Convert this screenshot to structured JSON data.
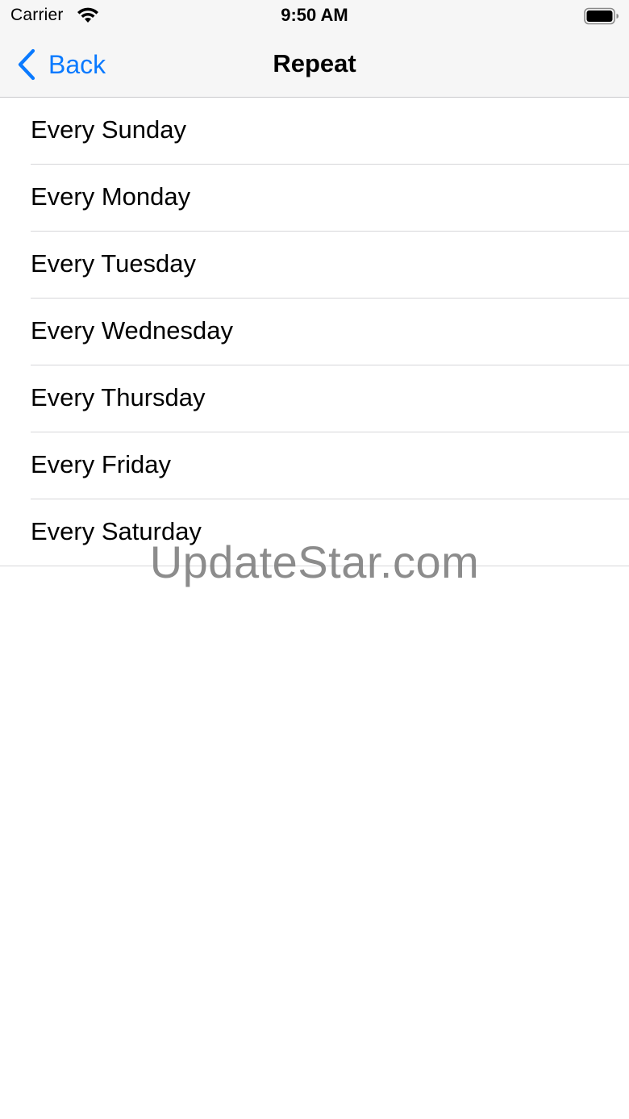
{
  "status_bar": {
    "carrier": "Carrier",
    "time": "9:50 AM",
    "wifi_icon": "wifi-icon",
    "battery_icon": "battery-icon"
  },
  "nav_bar": {
    "back_label": "Back",
    "back_icon": "chevron-left-icon",
    "title": "Repeat",
    "accent_color": "#0a7aff"
  },
  "repeat_options": [
    {
      "label": "Every Sunday"
    },
    {
      "label": "Every Monday"
    },
    {
      "label": "Every Tuesday"
    },
    {
      "label": "Every Wednesday"
    },
    {
      "label": "Every Thursday"
    },
    {
      "label": "Every Friday"
    },
    {
      "label": "Every Saturday"
    }
  ],
  "watermark": "UpdateStar.com"
}
